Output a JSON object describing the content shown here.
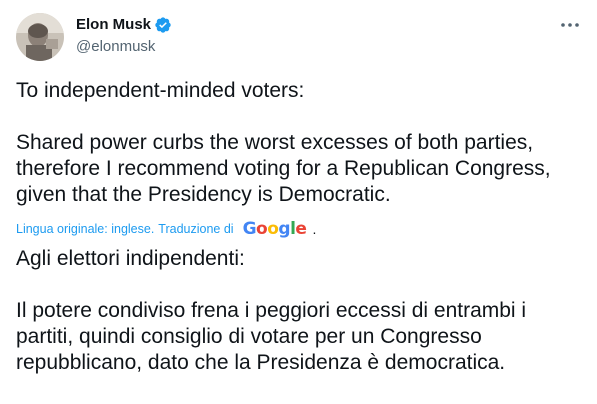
{
  "author": {
    "display_name": "Elon Musk",
    "handle": "@elonmusk",
    "verified": true
  },
  "icons": {
    "verified": "verified-badge-icon",
    "more": "more-options-icon"
  },
  "tweet": {
    "original_text": "To independent-minded voters:\n\nShared power curbs the worst excesses of both parties, therefore I recommend voting for a Republican Congress, given that the Presidency is Democratic.",
    "translation_note": {
      "language_label": "Lingua originale: inglese.",
      "translated_by": "Traduzione di",
      "provider": "Google",
      "trailing": "."
    },
    "translated_text": "Agli elettori indipendenti:\n\nIl potere condiviso frena i peggiori eccessi di entrambi i partiti, quindi consiglio di votare per un Congresso repubblicano, dato che la Presidenza è democratica."
  },
  "colors": {
    "link": "#1d9bf0",
    "secondary_text": "#536471",
    "primary_text": "#0f1419",
    "verified_badge": "#1d9bf0"
  }
}
